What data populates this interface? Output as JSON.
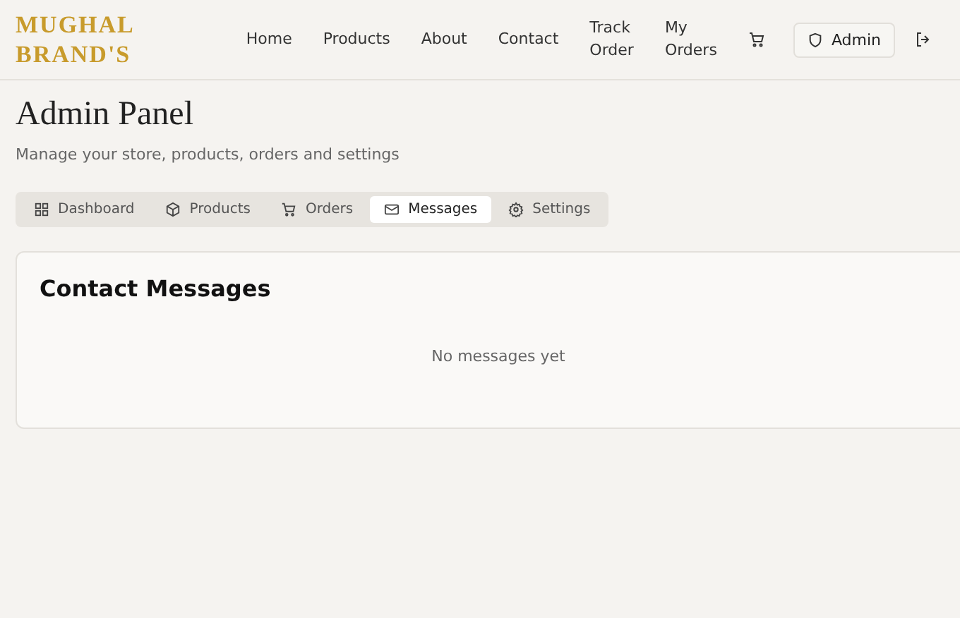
{
  "brand": [
    "MUGHAL",
    "BRAND'S"
  ],
  "nav": [
    {
      "label": "Home"
    },
    {
      "label": "Products"
    },
    {
      "label": "About"
    },
    {
      "label": "Contact"
    },
    {
      "label": "Track\nOrder"
    },
    {
      "label": "My\nOrders"
    }
  ],
  "admin_button": "Admin",
  "page": {
    "title": "Admin Panel",
    "subtitle": "Manage your store, products, orders and settings"
  },
  "tabs": [
    {
      "label": "Dashboard",
      "kind": "grid",
      "selected": false
    },
    {
      "label": "Products",
      "kind": "box",
      "selected": false
    },
    {
      "label": "Orders",
      "kind": "cart",
      "selected": false
    },
    {
      "label": "Messages",
      "kind": "mail",
      "selected": true
    },
    {
      "label": "Settings",
      "kind": "gear",
      "selected": false
    }
  ],
  "panel": {
    "title": "Contact Messages",
    "empty_text": "No messages yet"
  }
}
